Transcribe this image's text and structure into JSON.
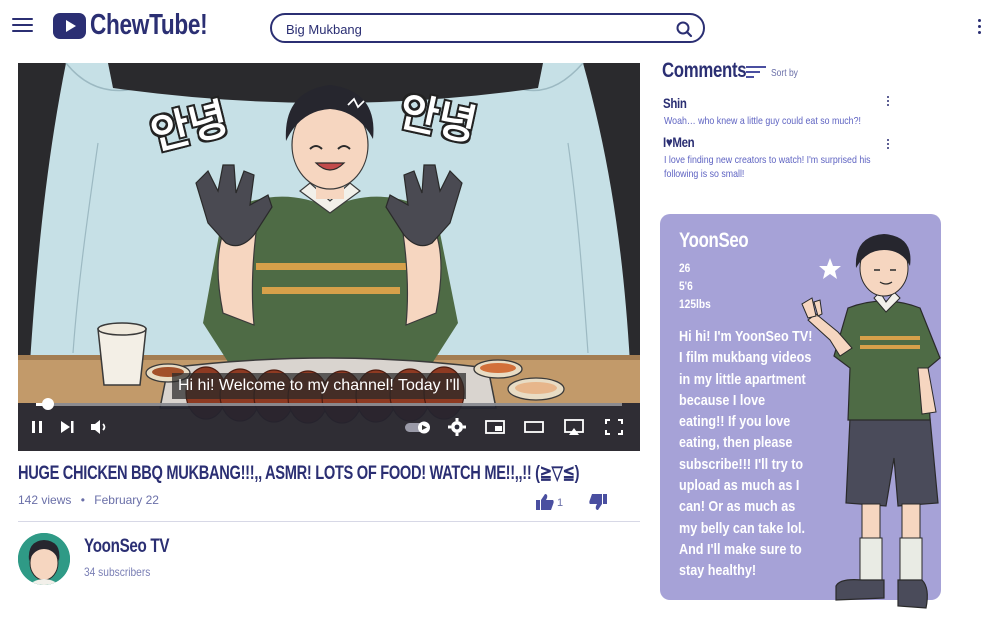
{
  "header": {
    "logo_text": "ChewTube!",
    "search_value": "Big Mukbang"
  },
  "video": {
    "caption": "Hi hi! Welcome to my channel! Today I'll",
    "title": "HUGE CHICKEN BBQ MUKBANG!!!,, ASMR! LOTS OF FOOD! WATCH ME!!,,!! (≧▽≦)",
    "views": "142 views",
    "date": "February 22",
    "likes": "1",
    "progress": 0.02,
    "scene_text_left": "안녕",
    "scene_text_right": "안녕"
  },
  "channel": {
    "name": "YoonSeo TV",
    "subscribers": "34 subscribers"
  },
  "comments": {
    "title": "Comments",
    "sort_label": "Sort by",
    "items": [
      {
        "author": "Shin",
        "text": "Woah… who knew a little guy could eat so much?!"
      },
      {
        "author": "I♥Men",
        "text": "I love finding new creators to watch! I'm surprised his following is so small!"
      }
    ]
  },
  "profile": {
    "name": "YoonSeo",
    "age": "26",
    "height": "5'6",
    "weight": "125lbs",
    "bio": "Hi hi! I'm YoonSeo TV! I film mukbang videos in my little apartment because I love eating!! If you love eating, then please subscribe!!! I'll try to upload as much as I can! Or as much as my belly can take lol. And I'll make sure to stay healthy!"
  },
  "colors": {
    "navy": "#2b2f73",
    "card": "#a6a2d7",
    "shirt": "#4e6b45",
    "backdrop": "#c6e0e6"
  }
}
